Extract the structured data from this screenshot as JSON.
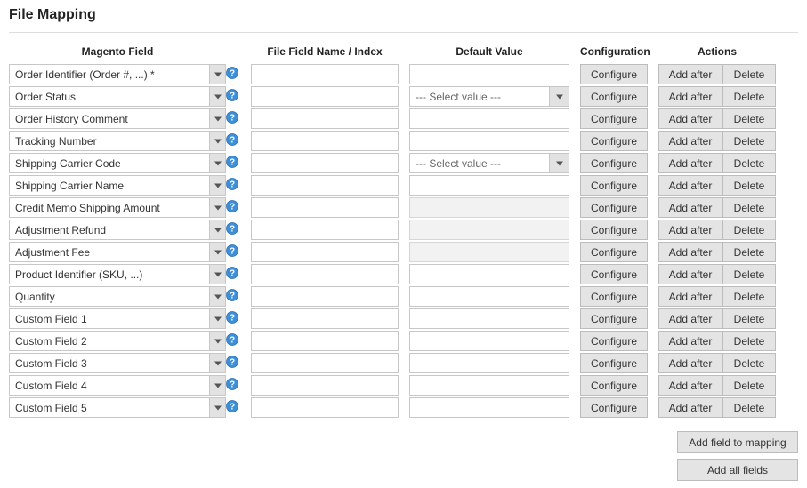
{
  "title": "File Mapping",
  "headers": {
    "magento_field": "Magento Field",
    "file_field": "File Field Name / Index",
    "default_value": "Default Value",
    "configuration": "Configuration",
    "actions": "Actions"
  },
  "labels": {
    "configure": "Configure",
    "add_after": "Add after",
    "delete": "Delete",
    "add_field_to_mapping": "Add field to mapping",
    "add_all_fields": "Add all fields",
    "select_value": "--- Select value ---"
  },
  "rows": [
    {
      "magento_field": "Order Identifier (Order #, ...) *",
      "file_field": "",
      "default_type": "text",
      "default_value": ""
    },
    {
      "magento_field": "Order Status",
      "file_field": "",
      "default_type": "select",
      "default_value": ""
    },
    {
      "magento_field": "Order History Comment",
      "file_field": "",
      "default_type": "text",
      "default_value": ""
    },
    {
      "magento_field": "Tracking Number",
      "file_field": "",
      "default_type": "text",
      "default_value": ""
    },
    {
      "magento_field": "Shipping Carrier Code",
      "file_field": "",
      "default_type": "select",
      "default_value": ""
    },
    {
      "magento_field": "Shipping Carrier Name",
      "file_field": "",
      "default_type": "text",
      "default_value": ""
    },
    {
      "magento_field": "Credit Memo Shipping Amount",
      "file_field": "",
      "default_type": "disabled",
      "default_value": ""
    },
    {
      "magento_field": "Adjustment Refund",
      "file_field": "",
      "default_type": "disabled",
      "default_value": ""
    },
    {
      "magento_field": "Adjustment Fee",
      "file_field": "",
      "default_type": "disabled",
      "default_value": ""
    },
    {
      "magento_field": "Product Identifier (SKU, ...)",
      "file_field": "",
      "default_type": "text",
      "default_value": ""
    },
    {
      "magento_field": "Quantity",
      "file_field": "",
      "default_type": "text",
      "default_value": ""
    },
    {
      "magento_field": "Custom Field 1",
      "file_field": "",
      "default_type": "text",
      "default_value": ""
    },
    {
      "magento_field": "Custom Field 2",
      "file_field": "",
      "default_type": "text",
      "default_value": ""
    },
    {
      "magento_field": "Custom Field 3",
      "file_field": "",
      "default_type": "text",
      "default_value": ""
    },
    {
      "magento_field": "Custom Field 4",
      "file_field": "",
      "default_type": "text",
      "default_value": ""
    },
    {
      "magento_field": "Custom Field 5",
      "file_field": "",
      "default_type": "text",
      "default_value": ""
    }
  ]
}
